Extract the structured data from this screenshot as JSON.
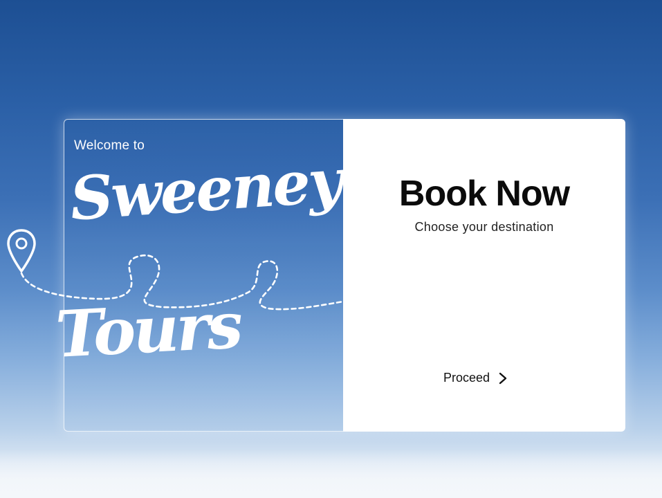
{
  "hero": {
    "welcome_text": "Welcome to",
    "brand_line1": "Sweeney",
    "brand_line2": "Tours"
  },
  "booking": {
    "title": "Book Now",
    "subtitle": "Choose your destination",
    "proceed_label": "Proceed",
    "proceed_icon": "chevron-right-icon"
  },
  "decoration": {
    "pin_icon": "location-pin-icon",
    "path_style": "dashed flight path"
  },
  "colors": {
    "sky_top": "#1d4f93",
    "sky_bottom": "#eef3f9",
    "panel_bg": "#ffffff",
    "title_text": "#0b0b0b"
  }
}
